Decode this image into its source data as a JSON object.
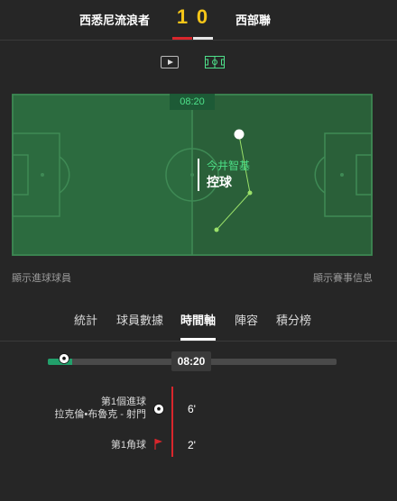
{
  "match": {
    "home_team": "西悉尼流浪者",
    "away_team": "西部聯",
    "home_score": "1",
    "away_score": "0"
  },
  "field": {
    "time": "08:20",
    "player_name": "今井智基",
    "player_action": "控球",
    "show_scorers_link": "顯示進球球員",
    "show_events_link": "顯示賽事信息"
  },
  "tabs": [
    "統計",
    "球員數據",
    "時間軸",
    "陣容",
    "積分榜"
  ],
  "active_tab": "時間軸",
  "timeline": {
    "current_time": "08:20",
    "progress_fraction": 0.083
  },
  "events": [
    {
      "title": "第1個進球",
      "detail": "拉克倫•布魯克 - 射門",
      "minute": "6'",
      "icon": "soccer-ball-icon"
    },
    {
      "title": "第1角球",
      "detail": "",
      "minute": "2'",
      "icon": "corner-flag-icon"
    }
  ],
  "colors": {
    "background": "#262626",
    "pitch": "#2a6a3e",
    "score": "#f5c518",
    "home_accent": "#d9262c",
    "player_highlight": "#4cdf86"
  }
}
